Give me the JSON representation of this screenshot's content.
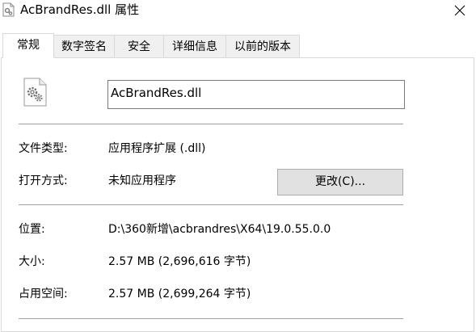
{
  "window": {
    "title": "AcBrandRes.dll 属性"
  },
  "tabs": [
    {
      "label": "常规",
      "active": true
    },
    {
      "label": "数字签名",
      "active": false
    },
    {
      "label": "安全",
      "active": false
    },
    {
      "label": "详细信息",
      "active": false
    },
    {
      "label": "以前的版本",
      "active": false
    }
  ],
  "general": {
    "file_name": "AcBrandRes.dll",
    "file_type_label": "文件类型:",
    "file_type_value": "应用程序扩展 (.dll)",
    "opens_with_label": "打开方式:",
    "opens_with_value": "未知应用程序",
    "change_button": "更改(C)...",
    "location_label": "位置:",
    "location_value": "D:\\360新增\\acbrandres\\X64\\19.0.55.0.0",
    "size_label": "大小:",
    "size_value": "2.57 MB (2,696,616 字节)",
    "size_on_disk_label": "占用空间:",
    "size_on_disk_value": "2.57 MB (2,699,264 字节)"
  },
  "icons": {
    "title": "dll-file-icon",
    "file": "dll-settings-file-icon",
    "close": "close-icon"
  }
}
